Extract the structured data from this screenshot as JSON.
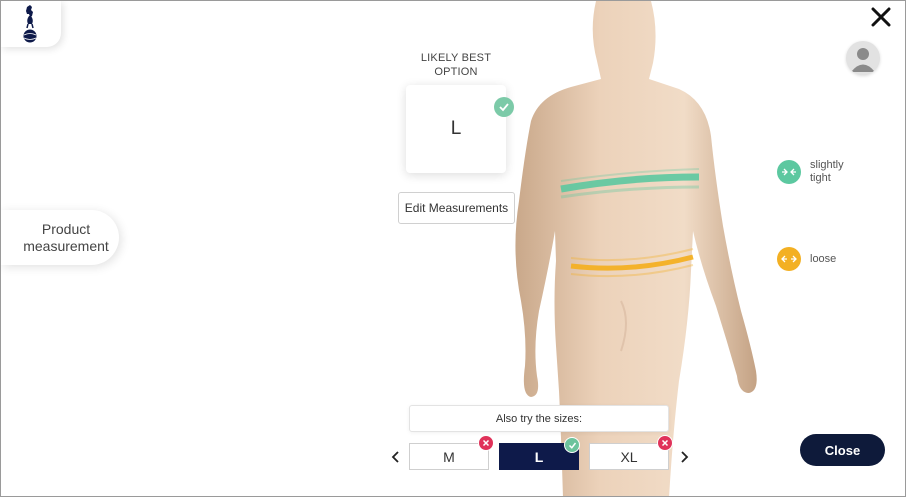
{
  "header": {
    "logo_icon": "cockerel-crest-icon",
    "close_icon": "close-icon",
    "avatar_icon": "user-avatar-icon"
  },
  "product_measurement": {
    "label_line1": "Product",
    "label_line2": "measurement"
  },
  "recommendation": {
    "title_line1": "LIKELY BEST",
    "title_line2": "OPTION",
    "size": "L",
    "check_icon": "check-icon",
    "edit_label": "Edit Measurements"
  },
  "fit": [
    {
      "label_line1": "slightly",
      "label_line2": "tight",
      "color": "#5cc8a0",
      "icon": "compress-arrows-icon"
    },
    {
      "label_line1": "loose",
      "label_line2": "",
      "color": "#f3b023",
      "icon": "expand-arrows-icon"
    }
  ],
  "sizes": {
    "title": "Also try the sizes:",
    "options": [
      {
        "label": "M",
        "status": "bad",
        "selected": false
      },
      {
        "label": "L",
        "status": "good",
        "selected": true
      },
      {
        "label": "XL",
        "status": "bad",
        "selected": false
      }
    ],
    "prev_icon": "chevron-left-icon",
    "next_icon": "chevron-right-icon"
  },
  "footer": {
    "close_label": "Close"
  },
  "colors": {
    "navy": "#0e1a4a",
    "good": "#6dc39c",
    "bad": "#e0325a",
    "chest_band": "#5cc8a0",
    "waist_band": "#f3b023"
  }
}
